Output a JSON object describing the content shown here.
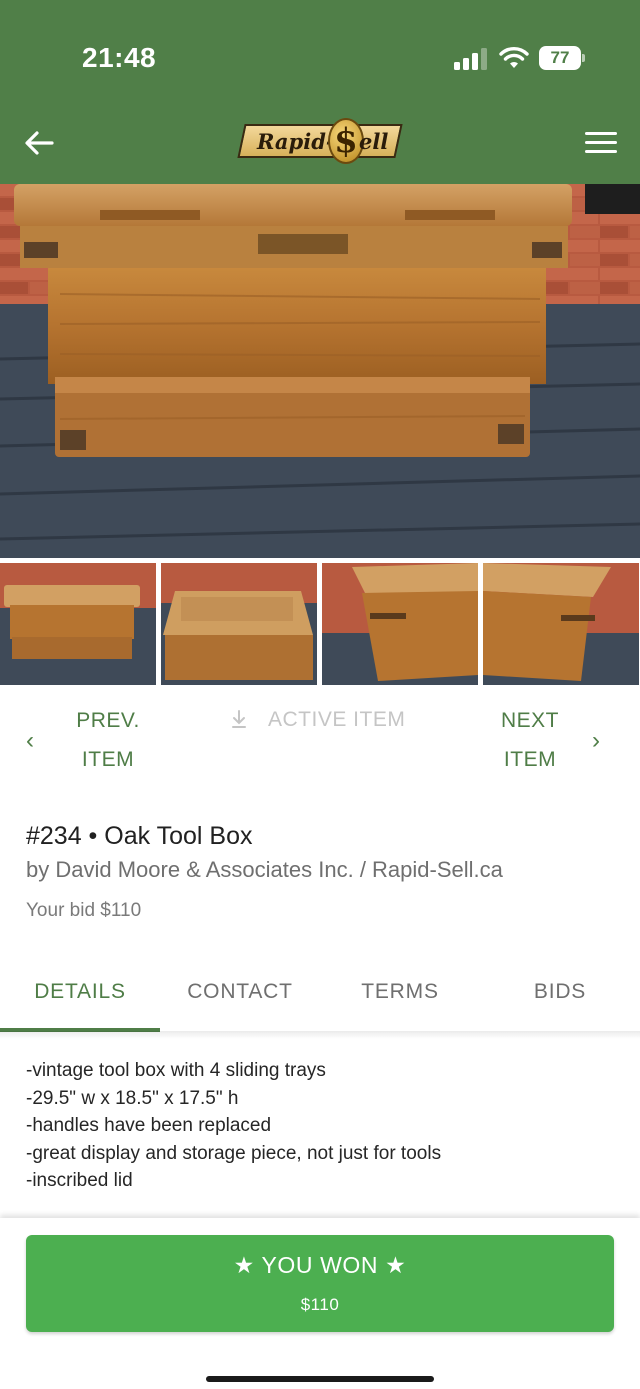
{
  "status_bar": {
    "time": "21:48",
    "battery": "77",
    "icons": [
      "signal-icon",
      "wifi-icon",
      "battery-icon"
    ]
  },
  "header": {
    "back_icon": "arrow-left-icon",
    "logo_left": "Rapid-",
    "logo_coin": "$",
    "logo_right": "ell",
    "menu_icon": "hamburger-menu-icon",
    "bg_color": "#507f48"
  },
  "photos": {
    "main": "oak-tool-box-front",
    "thumbnails": [
      "tool-box-front",
      "tool-box-top",
      "tool-box-side-left",
      "tool-box-side-right"
    ]
  },
  "nav": {
    "prev_line1": "PREV.",
    "prev_line2": "ITEM",
    "active_icon": "download-arrow-icon",
    "active_label": "ACTIVE ITEM",
    "next_line1": "NEXT",
    "next_line2": "ITEM",
    "prev_chevron": "‹",
    "next_chevron": "›"
  },
  "item": {
    "title": "#234 • Oak Tool Box",
    "seller": "by David Moore & Associates Inc. / Rapid-Sell.ca",
    "bid": "Your bid $110"
  },
  "tabs": [
    {
      "label": "DETAILS",
      "active": true
    },
    {
      "label": "CONTACT",
      "active": false
    },
    {
      "label": "TERMS",
      "active": false
    },
    {
      "label": "BIDS",
      "active": false
    }
  ],
  "description": [
    "-vintage tool box with 4 sliding trays",
    "-29.5\" w x 18.5\" x 17.5\" h",
    "-handles have been replaced",
    "-great display and storage piece, not just for tools",
    "-inscribed lid"
  ],
  "result_button": {
    "label": "★ YOU WON ★",
    "amount": "$110",
    "color": "#4caf50"
  },
  "colors": {
    "accent": "#4f7d47",
    "muted_text": "#6f6f6f"
  }
}
